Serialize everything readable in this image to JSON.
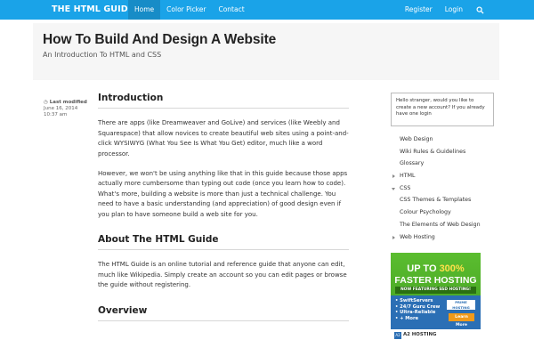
{
  "nav": {
    "brand": "THE HTML GUIDE",
    "links": [
      "Home",
      "Color Picker",
      "Contact"
    ],
    "right_links": [
      "Register",
      "Login"
    ],
    "search_icon": "search-icon"
  },
  "header": {
    "title": "How To Build And Design A Website",
    "subtitle": "An Introduction To HTML and CSS"
  },
  "meta": {
    "label": "Last modified",
    "date": "June 16, 2014",
    "time": "10:37 am",
    "icon": "clock-icon"
  },
  "content": {
    "intro_heading": "Introduction",
    "intro_p1": "There are apps (like Dreamweaver and GoLive) and services (like Weebly and Squarespace) that allow novices to create beautiful web sites using a point-and-click WYSIWYG (What You See Is What You Get) editor, much like a word processor.",
    "intro_p2": "However, we won't be using anything like that in this guide because those apps actually more cumbersome than typing out code (once you learn how to code). What's more, building a website is more than just a technical challenge. You need to have a basic understanding (and appreciation) of good design even if you plan to have someone build a web site for you.",
    "about_heading": "About The HTML Guide",
    "about_p1": "The HTML Guide is an online  tutorial and reference guide that anyone can edit, much like Wikipedia. Simply create an account so you can edit pages or browse the guide without registering.",
    "overview_heading": "Overview"
  },
  "sidebar": {
    "login_prompt": "Hello stranger, would you like to create a new account? If you already have one login",
    "items": [
      {
        "label": "Web Design",
        "arrow": ""
      },
      {
        "label": "Wiki Rules & Guidelines",
        "arrow": ""
      },
      {
        "label": "Glossary",
        "arrow": ""
      },
      {
        "label": "HTML",
        "arrow": "right"
      },
      {
        "label": "CSS",
        "arrow": "down"
      },
      {
        "label": "CSS Themes & Templates",
        "arrow": ""
      },
      {
        "label": "Colour Psychology",
        "arrow": ""
      },
      {
        "label": "The Elements of Web Design",
        "arrow": ""
      },
      {
        "label": "Web Hosting",
        "arrow": "right"
      }
    ]
  },
  "ad": {
    "line1_prefix": "UP TO ",
    "line1_highlight": "300%",
    "line2": "FASTER HOSTING",
    "strip": "NOW FEATURING SSD HOSTING!",
    "bullets": [
      "• SwiftServers",
      "• 24/7 Guru Crew",
      "• Ultra-Reliable",
      "• + More"
    ],
    "badge": "PRIME HOSTING +SSD",
    "cta": "Learn More",
    "brand": "A2 HOSTING",
    "brand_mark": "A2",
    "colors": {
      "green": "#4aab27",
      "blue": "#2b6fb5",
      "orange": "#f19a1a"
    }
  },
  "colors": {
    "nav_bg": "#1aa3e8",
    "nav_active": "#178cc7",
    "header_bg": "#f6f6f6"
  }
}
